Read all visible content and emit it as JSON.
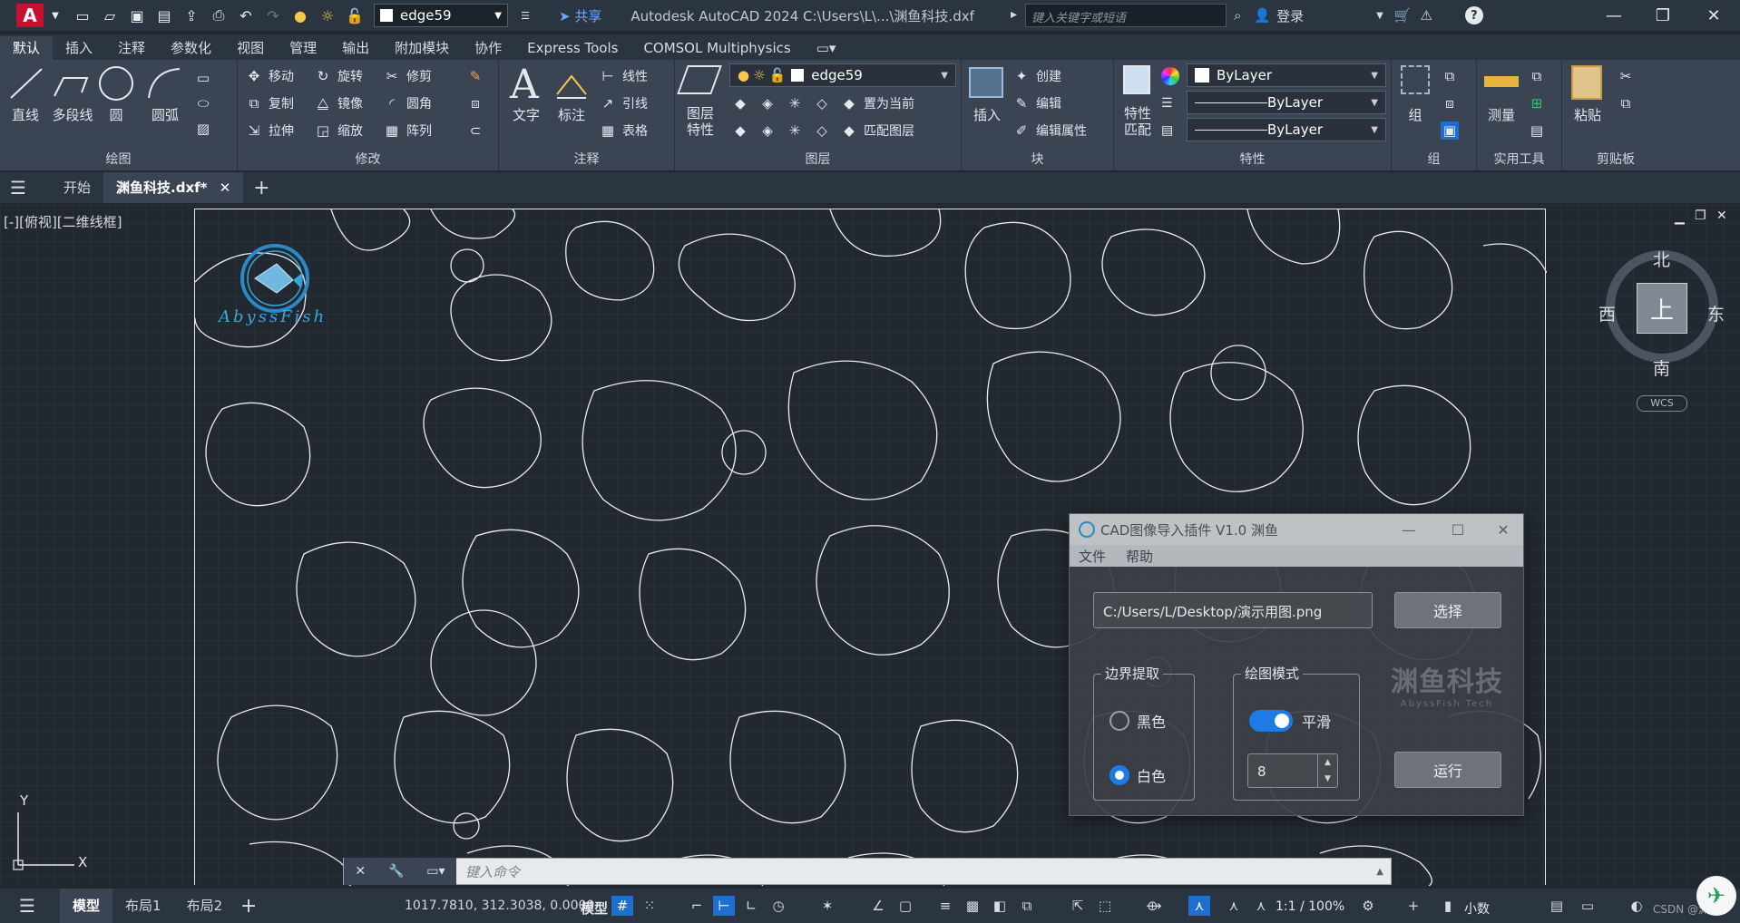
{
  "titlebar": {
    "layer_name": "edge59",
    "share": "共享",
    "app_title": "Autodesk AutoCAD 2024    C:\\Users\\L\\...\\渊鱼科技.dxf",
    "search_placeholder": "键入关键字或短语",
    "login": "登录"
  },
  "ribbon_tabs": [
    "默认",
    "插入",
    "注释",
    "参数化",
    "视图",
    "管理",
    "输出",
    "附加模块",
    "协作",
    "Express Tools",
    "COMSOL Multiphysics"
  ],
  "ribbon": {
    "draw": {
      "title": "绘图",
      "line": "直线",
      "polyline": "多段线",
      "circle": "圆",
      "arc": "圆弧"
    },
    "modify": {
      "title": "修改",
      "move": "移动",
      "rotate": "旋转",
      "trim": "修剪",
      "copy": "复制",
      "mirror": "镜像",
      "fillet": "圆角",
      "stretch": "拉伸",
      "scale": "缩放",
      "array": "阵列"
    },
    "annotation": {
      "title": "注释",
      "text": "文字",
      "dimension": "标注",
      "linear": "线性",
      "leader": "引线",
      "table": "表格"
    },
    "layers": {
      "title": "图层",
      "properties": "图层\n特性",
      "layer_combo": "edge59",
      "set_current": "置为当前",
      "match_layer": "匹配图层"
    },
    "block": {
      "title": "块",
      "insert": "插入",
      "create": "创建",
      "edit": "编辑",
      "edit_attr": "编辑属性"
    },
    "properties": {
      "title": "特性",
      "match": "特性\n匹配",
      "color": "ByLayer",
      "linetype": "ByLayer",
      "lineweight": "ByLayer"
    },
    "groups": {
      "title": "组",
      "group": "组"
    },
    "utilities": {
      "title": "实用工具",
      "measure": "测量"
    },
    "clipboard": {
      "title": "剪贴板",
      "paste": "粘贴"
    }
  },
  "doc_tabs": {
    "start": "开始",
    "file": "渊鱼科技.dxf*"
  },
  "viewport": {
    "label": "[-][俯视][二维线框]",
    "logo_text": "AbyssFish",
    "viewcube": {
      "north": "北",
      "south": "南",
      "east": "东",
      "west": "西",
      "top": "上",
      "wcs": "WCS"
    },
    "axis_x": "X",
    "axis_y": "Y"
  },
  "command": {
    "placeholder": "键入命令"
  },
  "statusbar": {
    "model_tab": "模型",
    "layout1": "布局1",
    "layout2": "布局2",
    "coords": "1017.7810, 312.3038, 0.0000",
    "model": "模型",
    "scale": "1:1 / 100%",
    "units": "小数",
    "csdn": "CSDN @渊鱼L"
  },
  "dialog": {
    "title": "CAD图像导入插件 V1.0 渊鱼",
    "menu": [
      "文件",
      "帮助"
    ],
    "path": "C:/Users/L/Desktop/演示用图.png",
    "select_button": "选择",
    "boundary_group": "边界提取",
    "black": "黑色",
    "white": "白色",
    "selected_boundary": "白色",
    "mode_group": "绘图模式",
    "smooth": "平滑",
    "smooth_on": true,
    "spin_value": "8",
    "run_button": "运行",
    "watermark_big": "渊鱼科技",
    "watermark_small": "AbyssFish Tech"
  },
  "colors": {
    "accent": "#1e7be6",
    "background": "#212830",
    "ribbon": "#3b4453",
    "autocad_red": "#c8102e"
  }
}
